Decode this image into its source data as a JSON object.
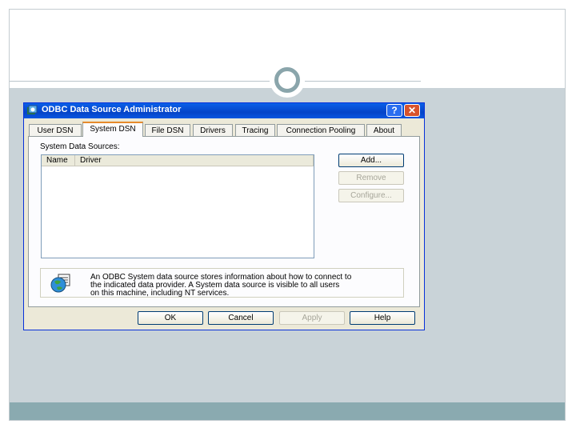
{
  "dialog": {
    "title": "ODBC Data Source Administrator",
    "title_buttons": {
      "help": "?",
      "close": "✕"
    },
    "icons": {
      "app": "odbc-app-icon",
      "info": "globe-database-icon"
    },
    "tabs": [
      {
        "label": "User DSN",
        "active": false
      },
      {
        "label": "System DSN",
        "active": true
      },
      {
        "label": "File DSN",
        "active": false
      },
      {
        "label": "Drivers",
        "active": false
      },
      {
        "label": "Tracing",
        "active": false
      },
      {
        "label": "Connection Pooling",
        "active": false
      },
      {
        "label": "About",
        "active": false
      }
    ],
    "group_label": "System Data Sources:",
    "columns": [
      "Name",
      "Driver"
    ],
    "rows": [],
    "side_buttons": {
      "add": "Add...",
      "remove": "Remove",
      "configure": "Configure..."
    },
    "info_lines": [
      "An ODBC System data source stores information about how to connect to",
      "the indicated data provider.   A System data source is visible to all users",
      "on this machine, including NT services."
    ],
    "footer_buttons": {
      "ok": "OK",
      "cancel": "Cancel",
      "apply": "Apply",
      "help": "Help"
    }
  },
  "colors": {
    "slide_content_bg": "#c9d3d8",
    "slide_footer_band": "#8aaab0",
    "title_bar_blue": "#0a5fe8",
    "close_button_red": "#d8532c",
    "active_tab_accent": "#e68b2c"
  }
}
